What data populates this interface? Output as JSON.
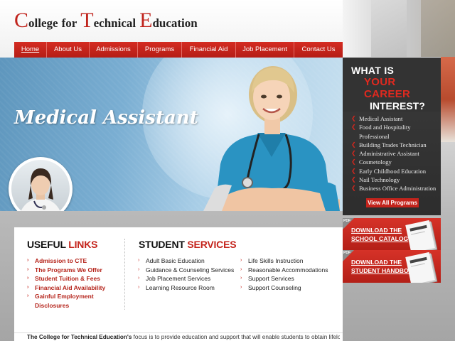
{
  "brand": {
    "logo_parts": [
      {
        "cap": "C",
        "rest": "ollege"
      },
      {
        "cap": "",
        "rest": "for"
      },
      {
        "cap": "T",
        "rest": "echnical"
      },
      {
        "cap": "E",
        "rest": "ducation"
      }
    ],
    "logo_text": "College for Technical Education"
  },
  "nav": {
    "items": [
      "Home",
      "About Us",
      "Admissions",
      "Programs",
      "Financial Aid",
      "Job Placement",
      "Contact Us"
    ],
    "active": "Home"
  },
  "banner": {
    "title": "Medical Assistant"
  },
  "career": {
    "line1": "WHAT IS",
    "line2": "YOUR CAREER",
    "line3": "INTEREST?",
    "programs": [
      "Medical Assistant",
      "Food and Hospitality",
      "Professional",
      "Building Trades Technician",
      "Administrative Assistant",
      "Cosmetology",
      "Early Childhood Education",
      "Nail Technology",
      "Business Office Administration"
    ],
    "view_all_label": "View All Programs"
  },
  "downloads": {
    "tag": "PDF",
    "catalog": {
      "line1": "DOWNLOAD THE",
      "line2": "SCHOOL CATALOG"
    },
    "handbook": {
      "line1": "DOWNLOAD THE",
      "line2": "STUDENT HANDBOOK"
    }
  },
  "useful_links": {
    "title_a": "USEFUL",
    "title_b": "LINKS",
    "items": [
      "Admission to CTE",
      "The Programs We Offer",
      "Student Tuition & Fees",
      "Financial Aid Availability",
      "Gainful Employment",
      "Disclosures"
    ]
  },
  "student_services": {
    "title_a": "STUDENT",
    "title_b": "SERVICES",
    "col1": [
      "Adult Basic Education",
      "Guidance & Counseling Services",
      "Job Placement Services",
      "Learning Resource Room"
    ],
    "col2": [
      "Life Skills Instruction",
      "Reasonable Accommodations",
      "Support Services",
      "Support Counseling"
    ]
  },
  "intro": {
    "bold": "The College for Technical Education's",
    "rest": " focus is to provide education and support that will enable students to obtain lifelong"
  },
  "colors": {
    "brand_red": "#c4241c",
    "nav_red": "#d42c22",
    "dark_panel": "#333333",
    "banner_blue": "#7aaed2"
  }
}
